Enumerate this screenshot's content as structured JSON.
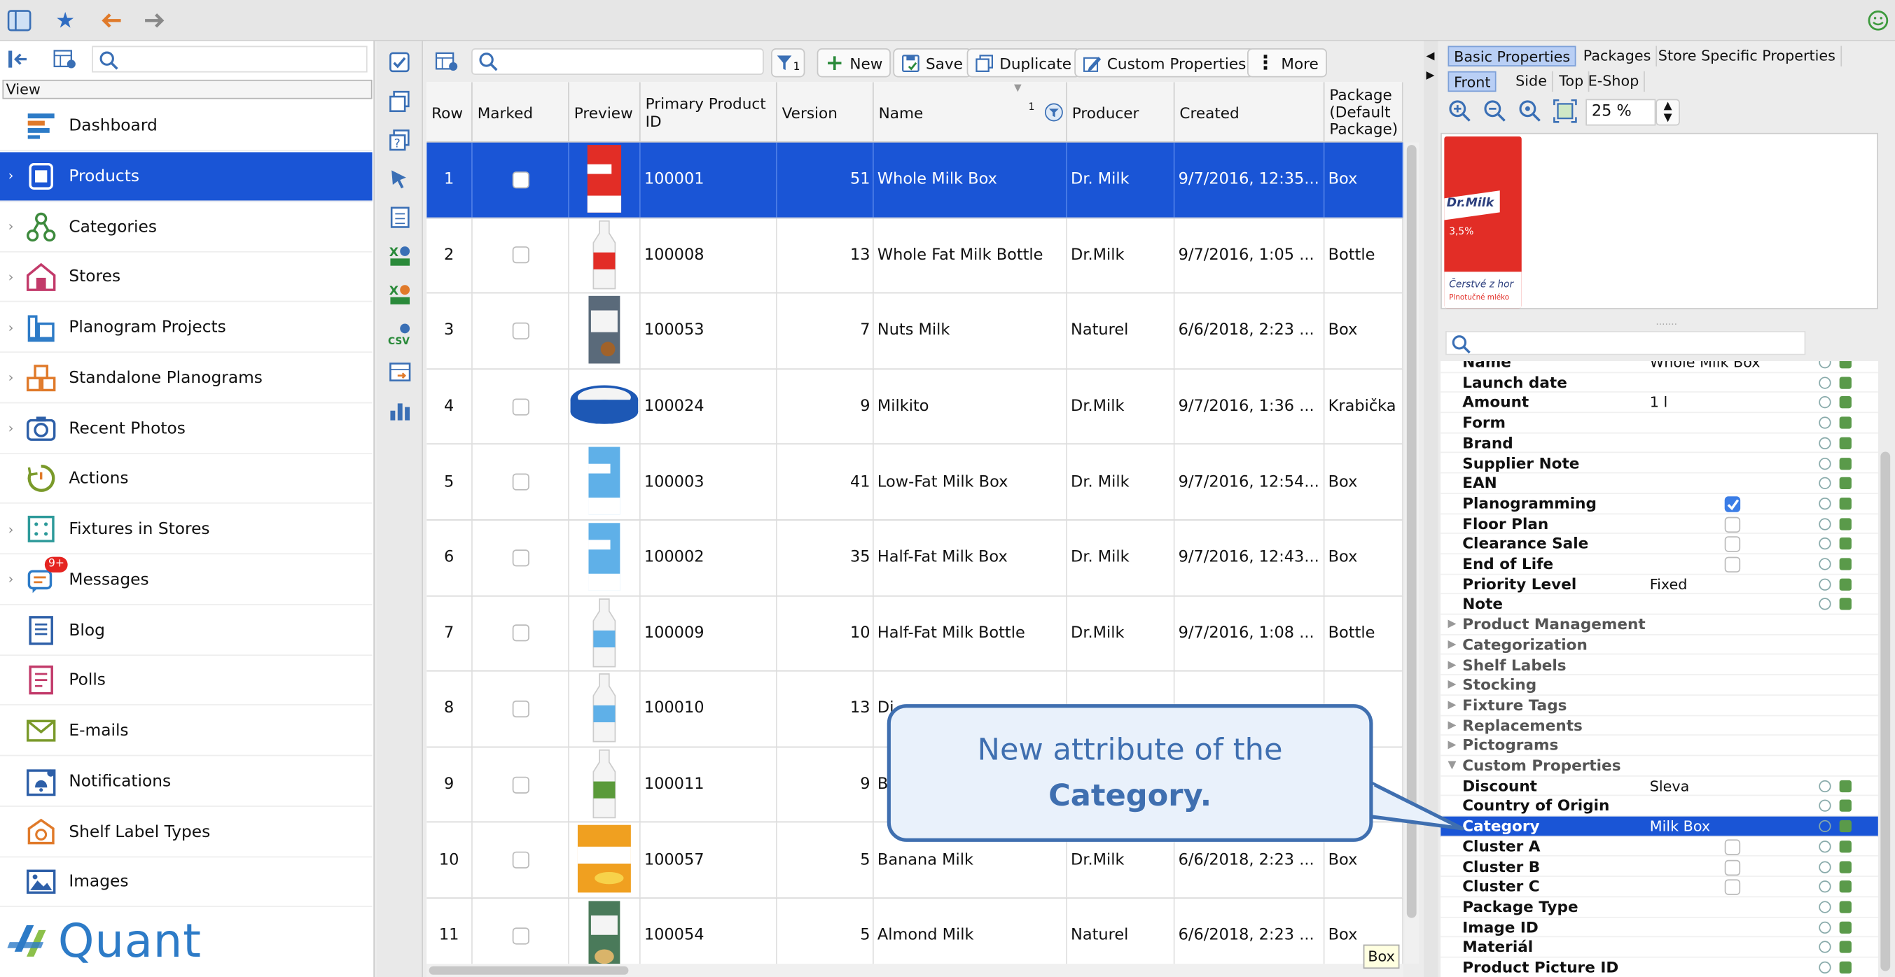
{
  "sidebar": {
    "view_label": "View",
    "items": [
      {
        "label": "Dashboard",
        "icon": "dashboard-icon",
        "selected": false,
        "chevron": false
      },
      {
        "label": "Products",
        "icon": "product-icon",
        "selected": true,
        "chevron": true
      },
      {
        "label": "Categories",
        "icon": "categories-icon",
        "selected": false,
        "chevron": true
      },
      {
        "label": "Stores",
        "icon": "store-icon",
        "selected": false,
        "chevron": true
      },
      {
        "label": "Planogram Projects",
        "icon": "planogram-projects-icon",
        "selected": false,
        "chevron": true
      },
      {
        "label": "Standalone Planograms",
        "icon": "standalone-planograms-icon",
        "selected": false,
        "chevron": true
      },
      {
        "label": "Recent Photos",
        "icon": "camera-icon",
        "selected": false,
        "chevron": true
      },
      {
        "label": "Actions",
        "icon": "actions-icon",
        "selected": false,
        "chevron": false
      },
      {
        "label": "Fixtures in Stores",
        "icon": "fixtures-icon",
        "selected": false,
        "chevron": true
      },
      {
        "label": "Messages",
        "icon": "messages-icon",
        "selected": false,
        "chevron": true,
        "badge": "9+"
      },
      {
        "label": "Blog",
        "icon": "blog-icon",
        "selected": false,
        "chevron": false
      },
      {
        "label": "Polls",
        "icon": "polls-icon",
        "selected": false,
        "chevron": false
      },
      {
        "label": "E-mails",
        "icon": "email-icon",
        "selected": false,
        "chevron": false
      },
      {
        "label": "Notifications",
        "icon": "notifications-icon",
        "selected": false,
        "chevron": false
      },
      {
        "label": "Shelf Label Types",
        "icon": "shelf-label-icon",
        "selected": false,
        "chevron": false
      },
      {
        "label": "Images",
        "icon": "images-icon",
        "selected": false,
        "chevron": false
      }
    ],
    "logo_text": "Quant"
  },
  "toolbar": {
    "filter_count": "1",
    "new_label": "New",
    "save_label": "Save",
    "duplicate_label": "Duplicate",
    "custom_props_label": "Custom Properties",
    "more_label": "More"
  },
  "grid": {
    "headers": [
      "Row",
      "Marked",
      "Preview",
      "Primary Product ID",
      "Version",
      "Name",
      "Producer",
      "Created",
      "Package (Default Package)"
    ],
    "sort_indicator": "1",
    "rows": [
      {
        "row": "1",
        "id": "100001",
        "version": "51",
        "name": "Whole Milk Box",
        "producer": "Dr. Milk",
        "created": "9/7/2016, 12:35...",
        "package": "Box",
        "selected": true,
        "thumb": "red-milk-box"
      },
      {
        "row": "2",
        "id": "100008",
        "version": "13",
        "name": "Whole Fat Milk Bottle",
        "producer": "Dr.Milk",
        "created": "9/7/2016, 1:05 ...",
        "package": "Bottle",
        "selected": false,
        "thumb": "red-milk-bottle"
      },
      {
        "row": "3",
        "id": "100053",
        "version": "7",
        "name": "Nuts Milk",
        "producer": "Naturel",
        "created": "6/6/2018, 2:23 ...",
        "package": "Box",
        "selected": false,
        "thumb": "nut-milk-box"
      },
      {
        "row": "4",
        "id": "100024",
        "version": "9",
        "name": "Milkito",
        "producer": "Dr.Milk",
        "created": "9/7/2016, 1:36 ...",
        "package": "Krabička",
        "selected": false,
        "thumb": "milkito-tin"
      },
      {
        "row": "5",
        "id": "100003",
        "version": "41",
        "name": "Low-Fat Milk Box",
        "producer": "Dr. Milk",
        "created": "9/7/2016, 12:54...",
        "package": "Box",
        "selected": false,
        "thumb": "blue-milk-box"
      },
      {
        "row": "6",
        "id": "100002",
        "version": "35",
        "name": "Half-Fat Milk Box",
        "producer": "Dr. Milk",
        "created": "9/7/2016, 12:43...",
        "package": "Box",
        "selected": false,
        "thumb": "blue-milk-box"
      },
      {
        "row": "7",
        "id": "100009",
        "version": "10",
        "name": "Half-Fat Milk Bottle",
        "producer": "Dr.Milk",
        "created": "9/7/2016, 1:08 ...",
        "package": "Bottle",
        "selected": false,
        "thumb": "blue-milk-bottle"
      },
      {
        "row": "8",
        "id": "100010",
        "version": "13",
        "name": "Di",
        "producer": "",
        "created": "",
        "package": "",
        "selected": false,
        "thumb": "blue-milk-bottle"
      },
      {
        "row": "9",
        "id": "100011",
        "version": "9",
        "name": "B",
        "producer": "",
        "created": "",
        "package": "",
        "selected": false,
        "thumb": "green-milk-bottle"
      },
      {
        "row": "10",
        "id": "100057",
        "version": "5",
        "name": "Banana Milk",
        "producer": "Dr.Milk",
        "created": "6/6/2018, 2:23 ...",
        "package": "Box",
        "selected": false,
        "thumb": "banana-milk-box"
      },
      {
        "row": "11",
        "id": "100054",
        "version": "5",
        "name": "Almond Milk",
        "producer": "Naturel",
        "created": "6/6/2018, 2:23 ...",
        "package": "Box",
        "selected": false,
        "thumb": "almond-milk-box"
      }
    ]
  },
  "right": {
    "tabs": [
      "Basic Properties",
      "Packages",
      "Store Specific Properties"
    ],
    "view_tabs": [
      "Front",
      "Side",
      "Top",
      "E-Shop"
    ],
    "zoom": "25 %",
    "preview_brand": "Dr.Milk",
    "preview_fat": "3,5%",
    "preview_tag1": "Čerstvé z hor",
    "preview_tag2": "Plnotučné mléko",
    "properties": [
      {
        "name": "Name",
        "value": "Whole Milk Box",
        "type": "text"
      },
      {
        "name": "Launch date",
        "value": "",
        "type": "text"
      },
      {
        "name": "Amount",
        "value": "1 l",
        "type": "text"
      },
      {
        "name": "Form",
        "value": "",
        "type": "text"
      },
      {
        "name": "Brand",
        "value": "",
        "type": "text"
      },
      {
        "name": "Supplier Note",
        "value": "",
        "type": "text"
      },
      {
        "name": "EAN",
        "value": "",
        "type": "text"
      },
      {
        "name": "Planogramming",
        "value": "",
        "type": "check_on"
      },
      {
        "name": "Floor Plan",
        "value": "",
        "type": "check"
      },
      {
        "name": "Clearance Sale",
        "value": "",
        "type": "check"
      },
      {
        "name": "End of Life",
        "value": "",
        "type": "check"
      },
      {
        "name": "Priority Level",
        "value": "Fixed",
        "type": "text"
      },
      {
        "name": "Note",
        "value": "",
        "type": "text"
      },
      {
        "name": "Product Management",
        "value": "",
        "type": "group"
      },
      {
        "name": "Categorization",
        "value": "",
        "type": "group"
      },
      {
        "name": "Shelf Labels",
        "value": "",
        "type": "group"
      },
      {
        "name": "Stocking",
        "value": "",
        "type": "group"
      },
      {
        "name": "Fixture Tags",
        "value": "",
        "type": "group"
      },
      {
        "name": "Replacements",
        "value": "",
        "type": "group"
      },
      {
        "name": "Pictograms",
        "value": "",
        "type": "group"
      },
      {
        "name": "Custom Properties",
        "value": "",
        "type": "group_open"
      },
      {
        "name": "Discount",
        "value": "Sleva",
        "type": "text"
      },
      {
        "name": "Country of Origin",
        "value": "",
        "type": "text"
      },
      {
        "name": "Category",
        "value": "Milk Box",
        "type": "selected"
      },
      {
        "name": "Cluster A",
        "value": "",
        "type": "check"
      },
      {
        "name": "Cluster B",
        "value": "",
        "type": "check"
      },
      {
        "name": "Cluster C",
        "value": "",
        "type": "check"
      },
      {
        "name": "Package Type",
        "value": "",
        "type": "text"
      },
      {
        "name": "Image ID",
        "value": "",
        "type": "text"
      },
      {
        "name": "Materiál",
        "value": "",
        "type": "text"
      },
      {
        "name": "Product Picture ID",
        "value": "",
        "type": "text"
      }
    ]
  },
  "callout": {
    "line1": "New attribute of the",
    "line2": "Category."
  },
  "tooltip": "Box",
  "colors": {
    "selection": "#1a55d6",
    "accent": "#3f6fb0",
    "logo": "#2d7bc7"
  }
}
